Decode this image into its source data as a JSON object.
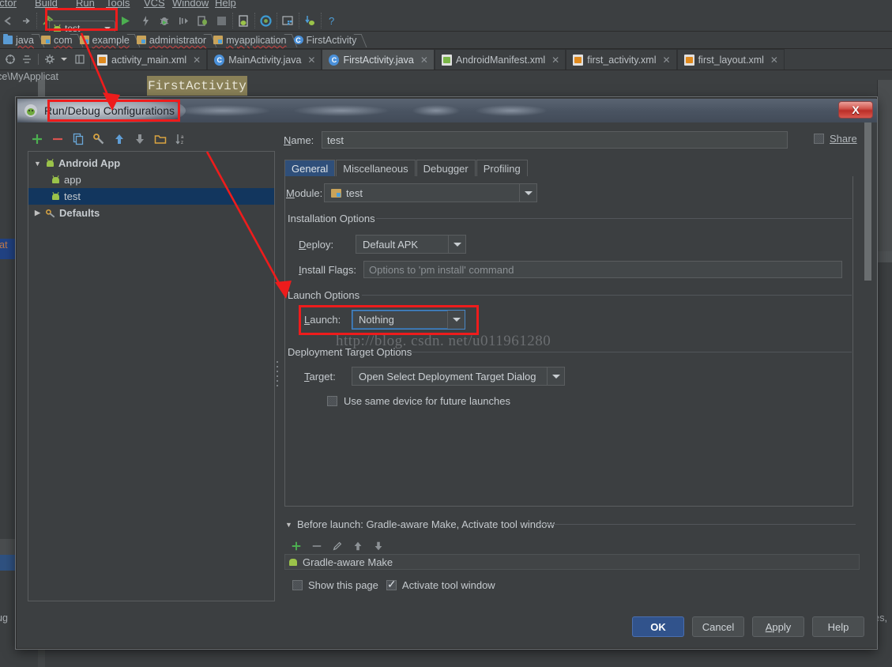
{
  "ide": {
    "menu": [
      "actor",
      "Build",
      "Run",
      "Tools",
      "VCS",
      "Window",
      "Help"
    ],
    "run_config_chip": {
      "label": "test",
      "icon": "android-app-icon"
    },
    "toolbar_icons": [
      "back-icon",
      "forward-icon",
      "build-hammer-icon",
      "run-icon",
      "attach-debugger-icon",
      "debug-icon",
      "step-icon",
      "stop-process-icon",
      "stop-icon",
      "avd-manager-icon",
      "sdk-manager-icon",
      "sync-gradle-icon",
      "layout-inspector-icon",
      "device-monitor-icon",
      "help-icon"
    ],
    "breadcrumb": [
      "java",
      "com",
      "example",
      "administrator",
      "myapplication",
      "FirstActivity"
    ],
    "editor_tabs": [
      {
        "label": "activity_main.xml",
        "icon": "xml-file-icon",
        "active": false
      },
      {
        "label": "MainActivity.java",
        "icon": "java-class-icon",
        "active": false
      },
      {
        "label": "FirstActivity.java",
        "icon": "java-class-icon",
        "active": true
      },
      {
        "label": "AndroidManifest.xml",
        "icon": "manifest-file-icon",
        "active": false
      },
      {
        "label": "first_activity.xml",
        "icon": "xml-file-icon",
        "active": false
      },
      {
        "label": "first_layout.xml",
        "icon": "xml-file-icon",
        "active": false
      }
    ],
    "path_hint": "space\\MyApplicat",
    "tooltip": "FirstActivity",
    "gutter_text": "rat",
    "bottom_left_text": "ug",
    "bottom_right_text": "ces,"
  },
  "dialog": {
    "title": "Run/Debug Configurations",
    "close_label": "X",
    "configs_toolbar": [
      "add-icon",
      "remove-icon",
      "copy-icon",
      "edit-templates-icon",
      "move-up-icon",
      "move-down-icon",
      "folder-icon",
      "sort-alphabetically-icon"
    ],
    "tree": [
      {
        "label": "Android App",
        "level": 0,
        "expanded": true,
        "bold": true,
        "icon": "android-app-icon",
        "selected": false
      },
      {
        "label": "app",
        "level": 1,
        "expanded": null,
        "bold": false,
        "icon": "android-app-icon",
        "selected": false
      },
      {
        "label": "test",
        "level": 1,
        "expanded": null,
        "bold": false,
        "icon": "android-app-icon",
        "selected": true
      },
      {
        "label": "Defaults",
        "level": 0,
        "expanded": false,
        "bold": true,
        "icon": "defaults-icon",
        "selected": false
      }
    ],
    "name": {
      "label": "Name:",
      "underline_char": "N",
      "value": "test"
    },
    "share": {
      "label": "Share",
      "checked": false
    },
    "tabs": [
      {
        "label": "General",
        "active": true
      },
      {
        "label": "Miscellaneous",
        "active": false
      },
      {
        "label": "Debugger",
        "active": false
      },
      {
        "label": "Profiling",
        "active": false
      }
    ],
    "module": {
      "label": "Module:",
      "value": "test",
      "icon": "module-icon"
    },
    "installation_options": {
      "group_title": "Installation Options",
      "deploy": {
        "label": "Deploy:",
        "value": "Default APK"
      },
      "install_flags": {
        "label": "Install Flags:",
        "value": "",
        "placeholder": "Options to 'pm install' command"
      }
    },
    "launch_options": {
      "group_title": "Launch Options",
      "launch": {
        "label": "Launch:",
        "value": "Nothing",
        "focused": true
      }
    },
    "deployment_target_options": {
      "group_title": "Deployment Target Options",
      "target": {
        "label": "Target:",
        "value": "Open Select Deployment Target Dialog"
      },
      "use_same_device": {
        "label": "Use same device for future launches",
        "checked": false
      }
    },
    "before_launch": {
      "header": "Before launch: Gradle-aware Make, Activate tool window",
      "toolbar": [
        "add-icon",
        "remove-icon",
        "edit-icon",
        "move-up-icon",
        "move-down-icon"
      ],
      "items": [
        {
          "label": "Gradle-aware Make",
          "icon": "gradle-android-icon"
        }
      ],
      "show_this_page": {
        "label": "Show this page",
        "checked": false
      },
      "activate_tool_window": {
        "label": "Activate tool window",
        "checked": true
      }
    },
    "buttons": [
      {
        "label": "OK",
        "default": true,
        "mnemonic": ""
      },
      {
        "label": "Cancel",
        "default": false,
        "mnemonic": ""
      },
      {
        "label": "Apply",
        "default": false,
        "mnemonic": "A"
      },
      {
        "label": "Help",
        "default": false,
        "mnemonic": ""
      }
    ]
  },
  "watermark": "http://blog. csdn. net/u011961280",
  "annotations": {
    "accent_color": "#ee1c1c",
    "boxes": [
      "run-config-chip-highlight",
      "dialog-title-highlight",
      "launch-option-highlight"
    ],
    "arrows": [
      "arrow-to-dialog-title",
      "arrow-to-launch-options"
    ]
  }
}
